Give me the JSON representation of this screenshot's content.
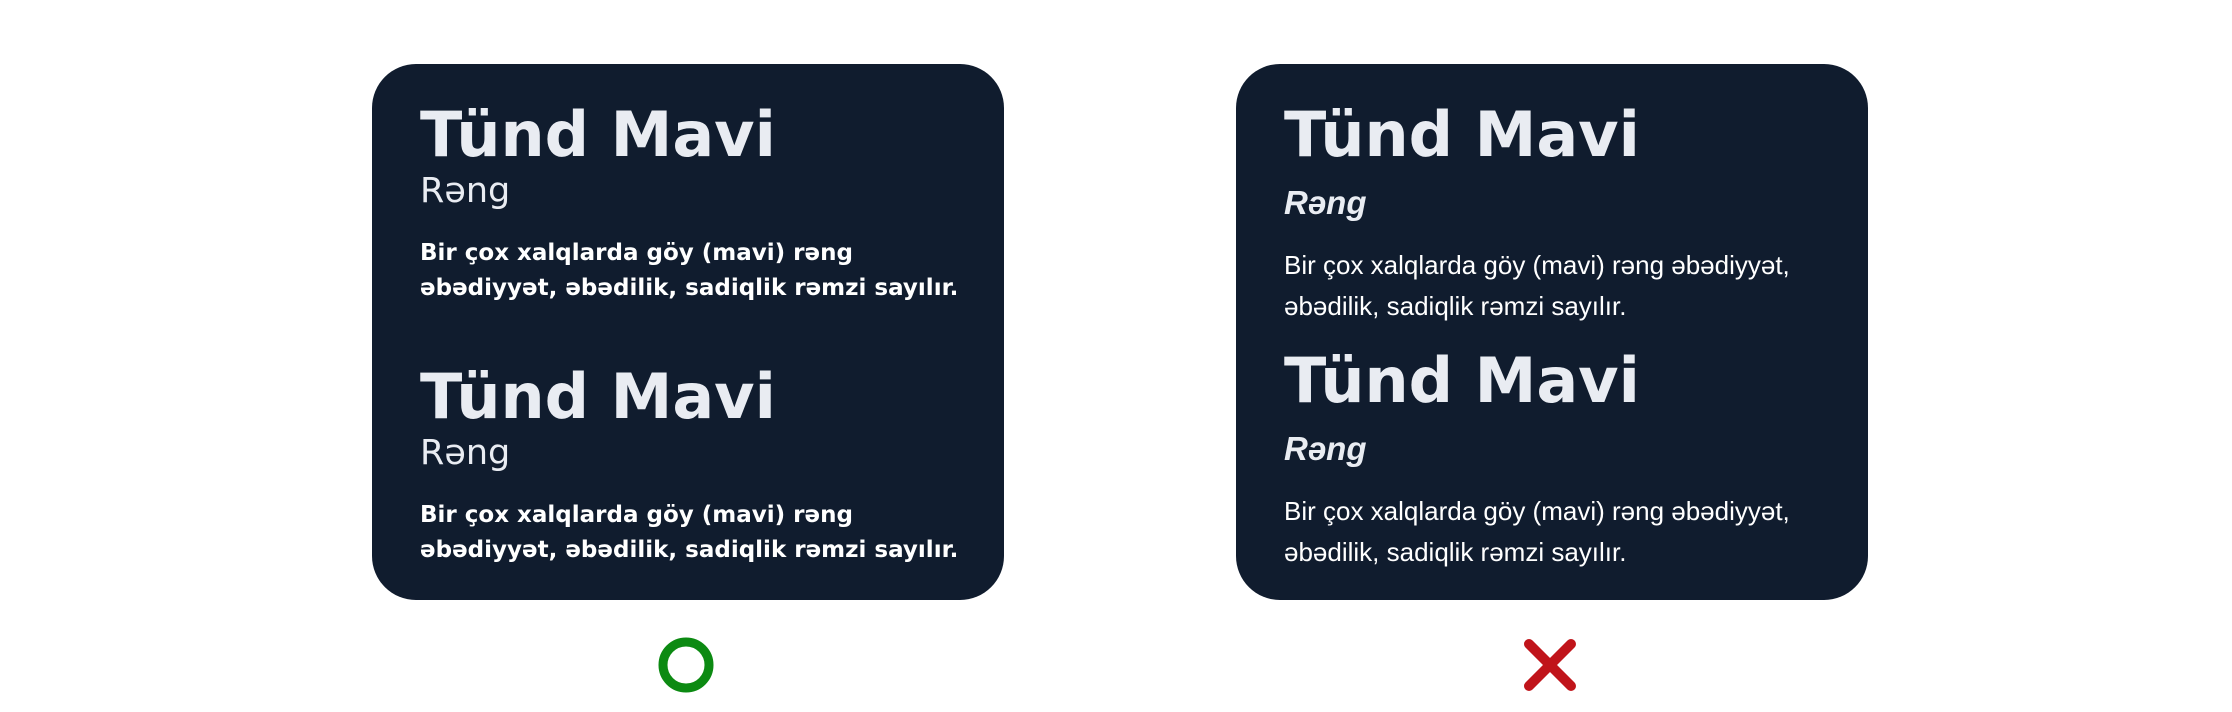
{
  "examples": [
    {
      "verdict": "correct",
      "verdict_icon": "circle-icon",
      "verdict_color": "#0c8a12",
      "card_color": "#101c2e",
      "blocks": [
        {
          "title": "Tünd Mavi",
          "subtitle": "Rəng",
          "body": "Bir çox xalqlarda göy (mavi) rəng əbədiyyət, əbədilik, sadiqlik rəmzi sayılır."
        },
        {
          "title": "Tünd Mavi",
          "subtitle": "Rəng",
          "body": "Bir çox xalqlarda göy (mavi) rəng əbədiyyət, əbədilik, sadiqlik rəmzi sayılır."
        }
      ]
    },
    {
      "verdict": "incorrect",
      "verdict_icon": "cross-icon",
      "verdict_color": "#c0141a",
      "card_color": "#101c2e",
      "blocks": [
        {
          "title": "Tünd Mavi",
          "subtitle": "Rəng",
          "body": "Bir çox xalqlarda göy (mavi) rəng əbədiyyət, əbədilik, sadiqlik rəmzi sayılır."
        },
        {
          "title": "Tünd Mavi",
          "subtitle": "Rəng",
          "body": "Bir çox xalqlarda göy (mavi) rəng əbədiyyət, əbədilik, sadiqlik rəmzi sayılır."
        }
      ]
    }
  ]
}
